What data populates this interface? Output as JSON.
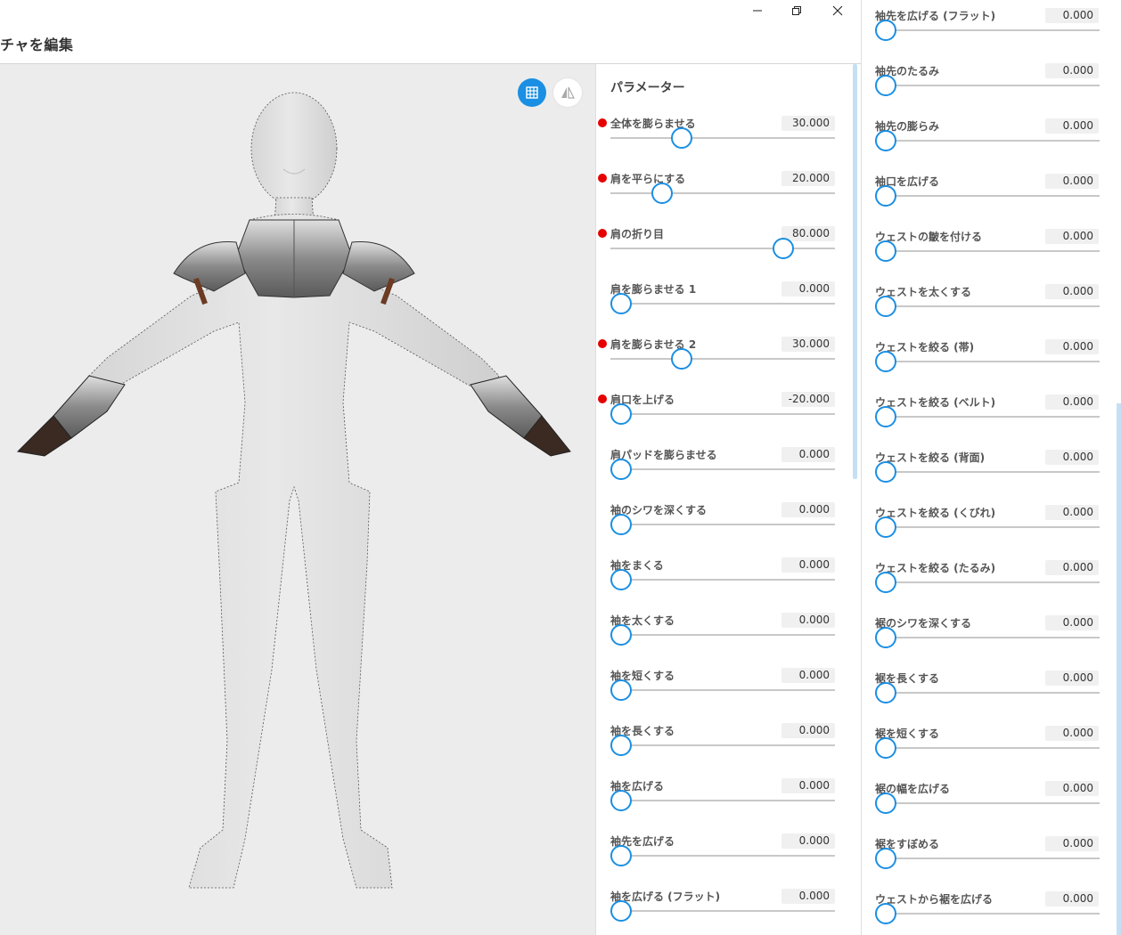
{
  "window": {
    "title": "チャを編集",
    "minimize_icon": "minimize-icon",
    "restore_icon": "restore-icon",
    "close_icon": "close-icon"
  },
  "viewport": {
    "grid_button_icon": "grid-icon",
    "mirror_button_icon": "mirror-icon",
    "accent": "#1a8fe3"
  },
  "panel": {
    "heading": "パラメーター",
    "left_params": [
      {
        "label": "全体を膨らませる",
        "value": "30.000",
        "modified": true,
        "level": 0.3
      },
      {
        "label": "肩を平らにする",
        "value": "20.000",
        "modified": true,
        "level": 0.2
      },
      {
        "label": "肩の折り目",
        "value": "80.000",
        "modified": true,
        "level": 0.8
      },
      {
        "label": "肩を膨らませる 1",
        "value": "0.000",
        "modified": false,
        "level": 0
      },
      {
        "label": "肩を膨らませる 2",
        "value": "30.000",
        "modified": true,
        "level": 0.3
      },
      {
        "label": "肩口を上げる",
        "value": "-20.000",
        "modified": true,
        "level": 0
      },
      {
        "label": "肩パッドを膨らませる",
        "value": "0.000",
        "modified": false,
        "level": 0
      },
      {
        "label": "袖のシワを深くする",
        "value": "0.000",
        "modified": false,
        "level": 0
      },
      {
        "label": "袖をまくる",
        "value": "0.000",
        "modified": false,
        "level": 0
      },
      {
        "label": "袖を太くする",
        "value": "0.000",
        "modified": false,
        "level": 0
      },
      {
        "label": "袖を短くする",
        "value": "0.000",
        "modified": false,
        "level": 0
      },
      {
        "label": "袖を長くする",
        "value": "0.000",
        "modified": false,
        "level": 0
      },
      {
        "label": "袖を広げる",
        "value": "0.000",
        "modified": false,
        "level": 0
      },
      {
        "label": "袖先を広げる",
        "value": "0.000",
        "modified": false,
        "level": 0
      },
      {
        "label": "袖を広げる (フラット)",
        "value": "0.000",
        "modified": false,
        "level": 0
      }
    ],
    "right_params": [
      {
        "label": "袖先を広げる (フラット)",
        "value": "0.000",
        "level": 0
      },
      {
        "label": "袖先のたるみ",
        "value": "0.000",
        "level": 0
      },
      {
        "label": "袖先の膨らみ",
        "value": "0.000",
        "level": 0
      },
      {
        "label": "袖口を広げる",
        "value": "0.000",
        "level": 0
      },
      {
        "label": "ウェストの皺を付ける",
        "value": "0.000",
        "level": 0
      },
      {
        "label": "ウェストを太くする",
        "value": "0.000",
        "level": 0
      },
      {
        "label": "ウェストを絞る (帯)",
        "value": "0.000",
        "level": 0
      },
      {
        "label": "ウェストを絞る (ベルト)",
        "value": "0.000",
        "level": 0
      },
      {
        "label": "ウェストを絞る (背面)",
        "value": "0.000",
        "level": 0
      },
      {
        "label": "ウェストを絞る (くびれ)",
        "value": "0.000",
        "level": 0
      },
      {
        "label": "ウェストを絞る (たるみ)",
        "value": "0.000",
        "level": 0
      },
      {
        "label": "裾のシワを深くする",
        "value": "0.000",
        "level": 0
      },
      {
        "label": "裾を長くする",
        "value": "0.000",
        "level": 0
      },
      {
        "label": "裾を短くする",
        "value": "0.000",
        "level": 0
      },
      {
        "label": "裾の幅を広げる",
        "value": "0.000",
        "level": 0
      },
      {
        "label": "裾をすぼめる",
        "value": "0.000",
        "level": 0
      },
      {
        "label": "ウェストから裾を広げる",
        "value": "0.000",
        "level": 0
      }
    ]
  }
}
